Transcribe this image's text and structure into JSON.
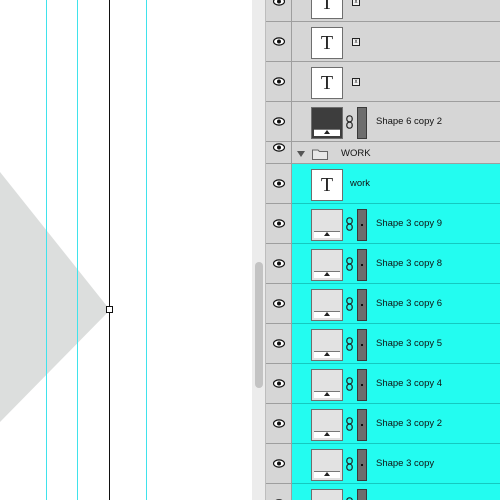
{
  "colors": {
    "guide": "#3fe3ec",
    "selection": "#23fcf0",
    "panel": "#d6d6d6",
    "shape_fill": "#dcdedd"
  },
  "layers": {
    "rows": [
      {
        "kind": "text",
        "name": "",
        "fx": "x",
        "selected": false
      },
      {
        "kind": "text",
        "name": "",
        "fx": "x",
        "selected": false
      },
      {
        "kind": "text",
        "name": "",
        "fx": "x",
        "selected": false
      },
      {
        "kind": "shape-dark",
        "name": "Shape 6 copy 2",
        "selected": false
      },
      {
        "kind": "group",
        "name": "WORK"
      },
      {
        "kind": "text",
        "name": "work",
        "selected": true
      },
      {
        "kind": "shape",
        "name": "Shape 3 copy 9",
        "selected": true
      },
      {
        "kind": "shape",
        "name": "Shape 3 copy 8",
        "selected": true
      },
      {
        "kind": "shape",
        "name": "Shape 3 copy 6",
        "selected": true
      },
      {
        "kind": "shape",
        "name": "Shape 3 copy 5",
        "selected": true
      },
      {
        "kind": "shape",
        "name": "Shape 3 copy 4",
        "selected": true
      },
      {
        "kind": "shape",
        "name": "Shape 3 copy 2",
        "selected": true
      },
      {
        "kind": "shape",
        "name": "Shape 3 copy",
        "selected": true
      },
      {
        "kind": "shape",
        "name": "",
        "selected": true
      }
    ],
    "thumb_glyph": "T"
  }
}
